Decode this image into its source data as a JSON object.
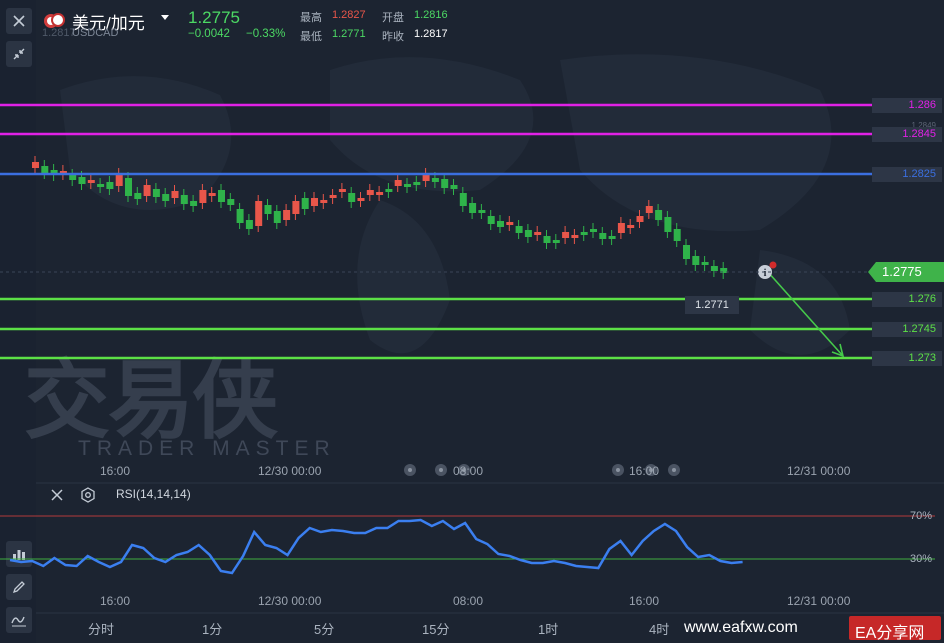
{
  "header": {
    "title": "美元/加元",
    "sub_code": "USDCAD",
    "sub_overlay": "1.2817",
    "price": "1.2775",
    "change": "−0.0042",
    "change_pct": "−0.33%",
    "high_label": "最高",
    "high_value": "1.2827",
    "open_label": "开盘",
    "open_value": "1.2816",
    "low_label": "最低",
    "low_value": "1.2771",
    "prev_label": "昨收",
    "prev_value": "1.2817"
  },
  "price_levels": {
    "l1": "1.286",
    "l2": "1.2845",
    "l2_ghost": "1.2849",
    "l3": "1.2825",
    "current": "1.2775",
    "l4": "1.276",
    "l5": "1.2745",
    "l6": "1.273",
    "last_low": "1.2771"
  },
  "colors": {
    "magenta": "#e021e6",
    "blue": "#3b6fe0",
    "green": "#5ce046",
    "up": "#e8564a",
    "down": "#2fb34a",
    "rsi": "#3b7ff0"
  },
  "xaxis": [
    "16:00",
    "12/30 00:00",
    "08:00",
    "16:00",
    "12/31 00:00"
  ],
  "indicator": {
    "label": "RSI(14,14,14)",
    "upper": "70%",
    "lower": "30%"
  },
  "timeframes": [
    "分时",
    "1分",
    "5分",
    "15分",
    "1时",
    "4时"
  ],
  "watermark": {
    "cn": "交易侠",
    "en": "TRADER MASTER"
  },
  "footer": {
    "site": "www.eafxw.com",
    "brand": "EA分享网"
  }
}
